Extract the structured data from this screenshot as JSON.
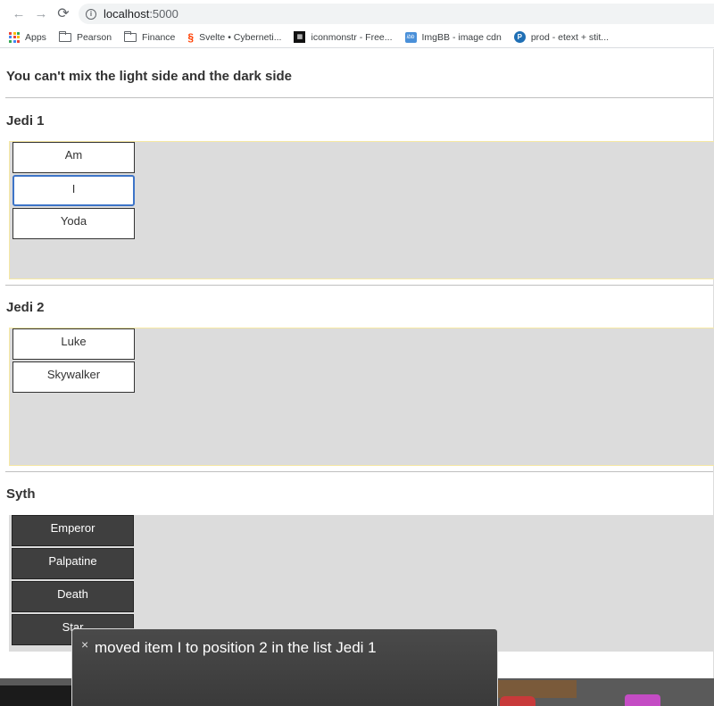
{
  "browser": {
    "url_host": "localhost",
    "url_port": ":5000",
    "bookmarks": [
      {
        "label": "Apps"
      },
      {
        "label": "Pearson"
      },
      {
        "label": "Finance"
      },
      {
        "label": "Svelte • Cyberneti..."
      },
      {
        "label": "iconmonstr - Free..."
      },
      {
        "label": "ImgBB - image cdn"
      },
      {
        "label": "prod - etext + stit..."
      }
    ]
  },
  "page": {
    "heading": "You can't mix the light side and the dark side"
  },
  "lists": [
    {
      "title": "Jedi 1",
      "items": [
        "Am",
        "I",
        "Yoda"
      ]
    },
    {
      "title": "Jedi 2",
      "items": [
        "Luke",
        "Skywalker"
      ]
    },
    {
      "title": "Syth",
      "items": [
        "Emperor",
        "Palpatine",
        "Death",
        "Star"
      ]
    }
  ],
  "toast": {
    "message": "moved item I to position 2 in the list Jedi 1"
  },
  "colors": {
    "zone": "#dcdcdc",
    "dark_card": "#3f3f3f",
    "focus": "#3d74c8",
    "toast": "#444444"
  }
}
